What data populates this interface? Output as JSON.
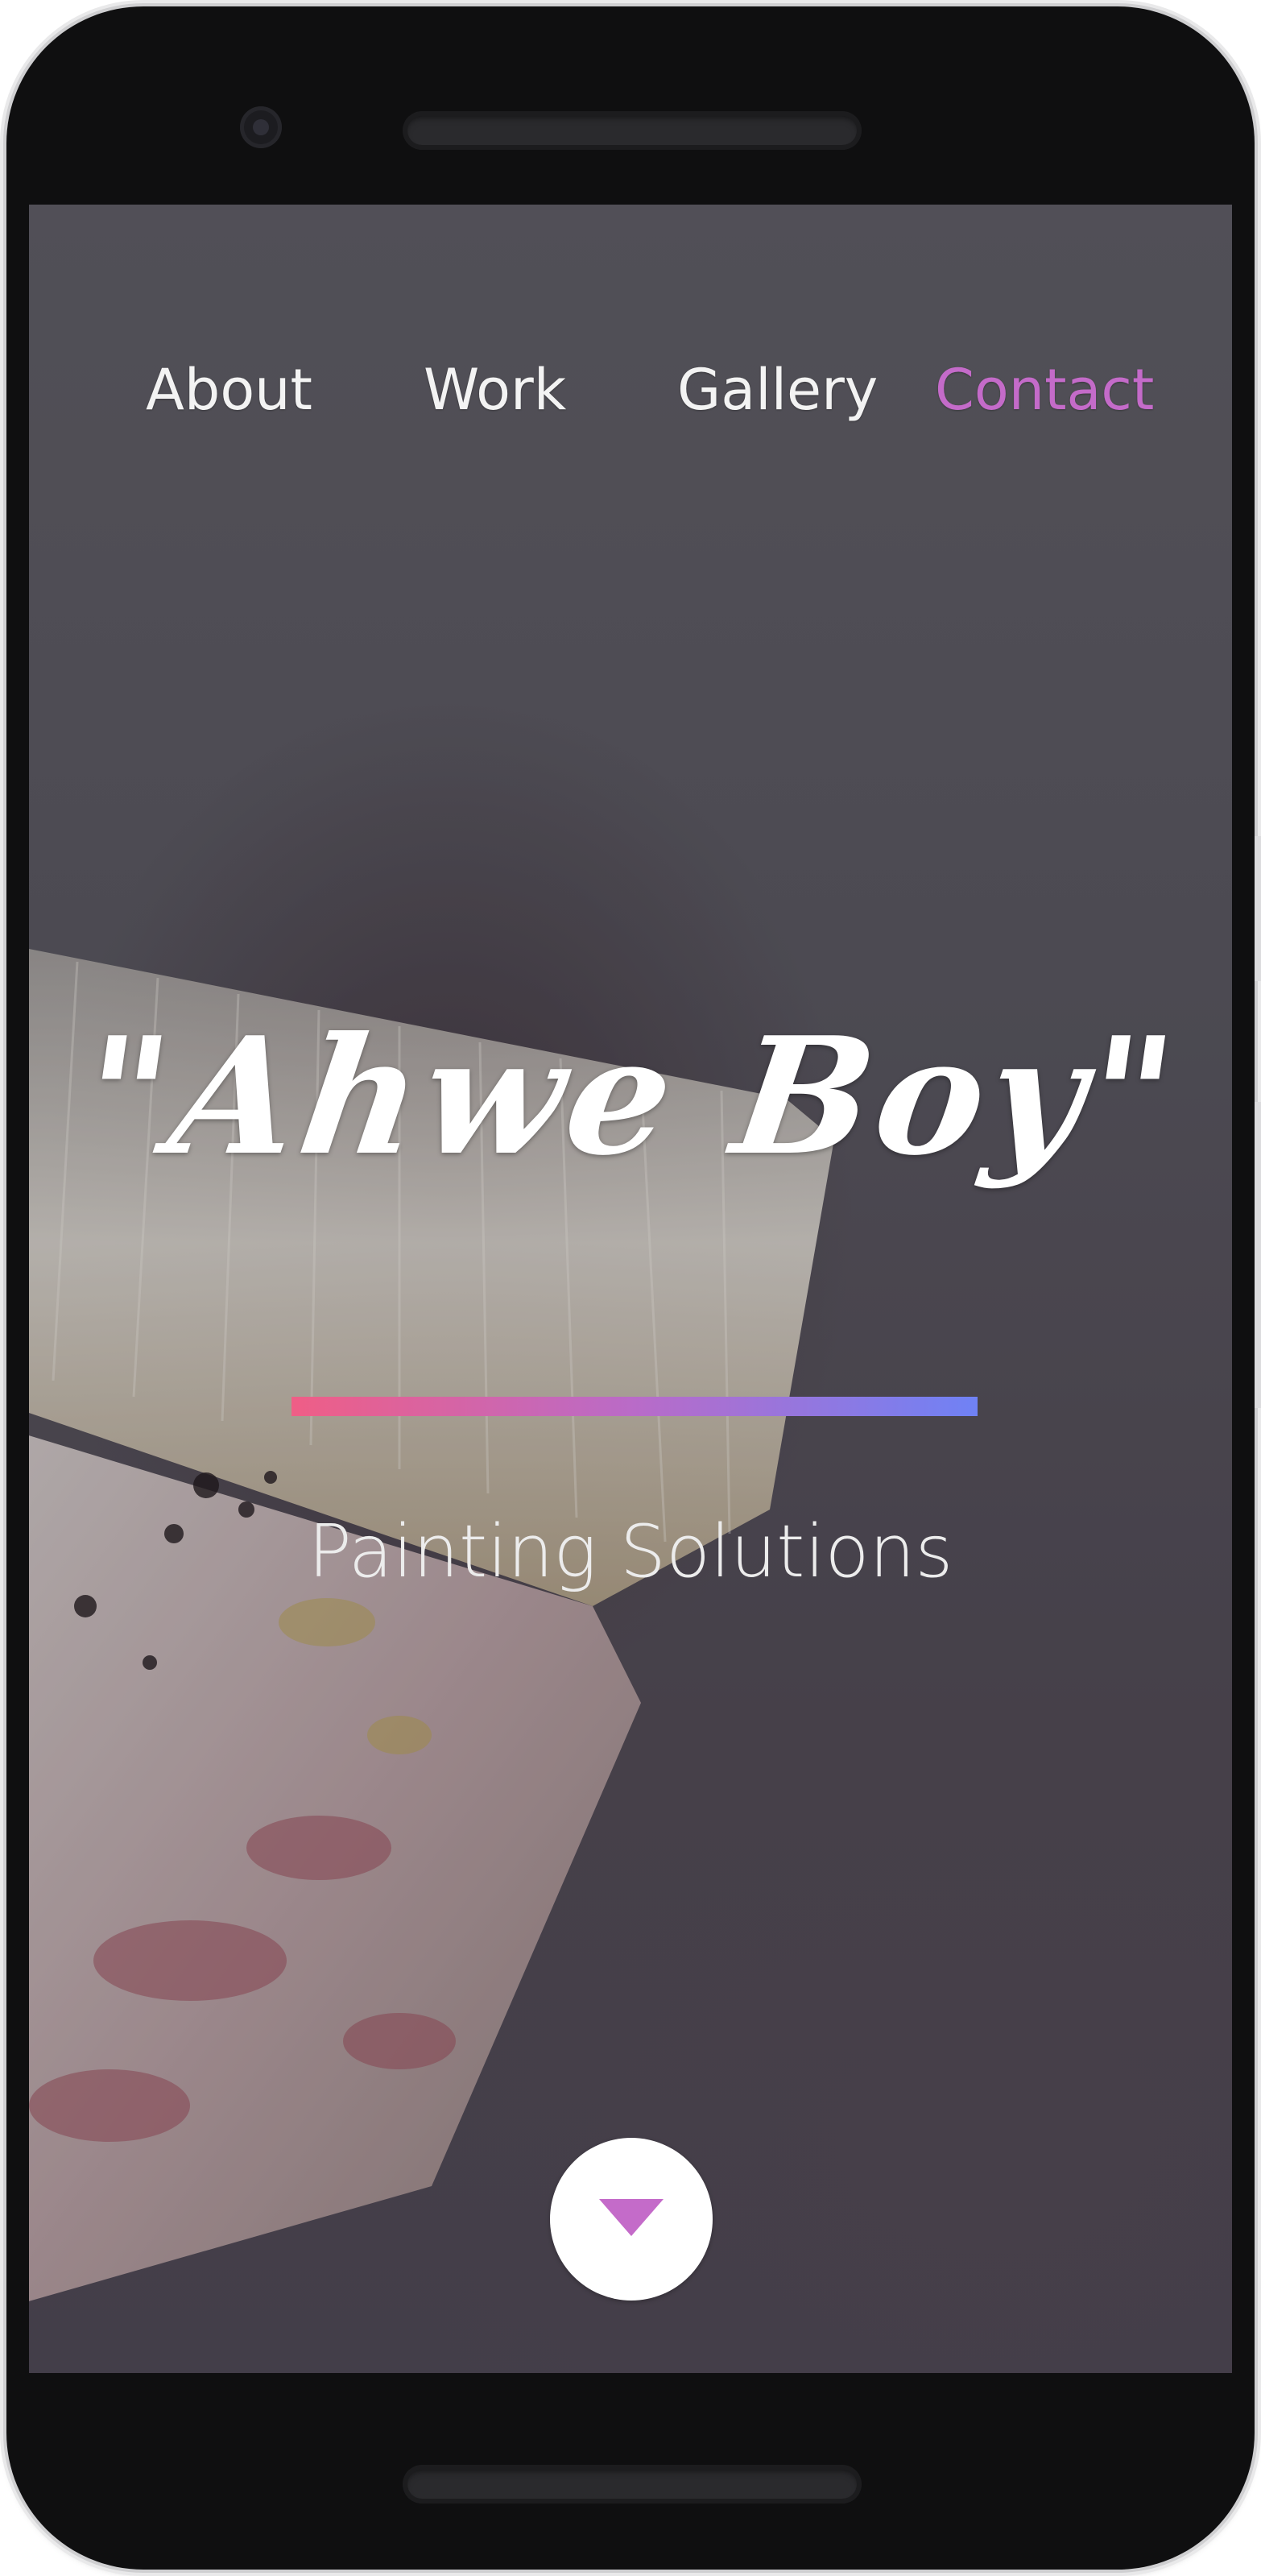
{
  "nav": {
    "items": [
      {
        "label": "About",
        "active": false
      },
      {
        "label": "Work",
        "active": false
      },
      {
        "label": "Gallery",
        "active": false
      },
      {
        "label": "Contact",
        "active": true
      }
    ],
    "active_color": "#c46bc9"
  },
  "hero": {
    "title": "\"Ahwe Boy\"",
    "tagline": "Painting Solutions",
    "accent_gradient": [
      "#ef5e86",
      "#b96bc8",
      "#6f82f5"
    ],
    "background_image": "paintbrush"
  },
  "scroll_button": {
    "icon": "triangle-down-icon",
    "icon_color": "#c46bc9"
  }
}
